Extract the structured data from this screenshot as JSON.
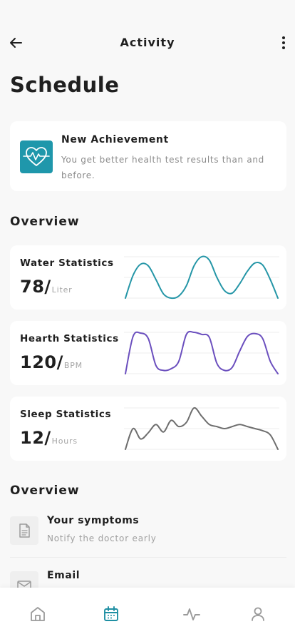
{
  "header": {
    "title": "Activity"
  },
  "page": {
    "heading": "Schedule"
  },
  "achievement": {
    "title": "New Achievement",
    "description": "You get better health test results than and before.",
    "icon": "heart-pulse-icon",
    "icon_bg": "#1f97ab"
  },
  "overview_title": "Overview",
  "stats": [
    {
      "title": "Water Statistics",
      "value": "78/",
      "unit": "Liter",
      "color": "#2596a7",
      "chart_data": {
        "type": "line",
        "x": [
          0,
          1,
          2,
          3,
          4,
          5,
          6,
          7,
          8,
          9,
          10,
          11,
          12,
          13,
          14,
          15,
          16,
          17,
          18,
          19,
          20
        ],
        "y": [
          0.0,
          0.55,
          0.82,
          0.78,
          0.45,
          0.1,
          0.0,
          0.05,
          0.3,
          0.78,
          1.0,
          0.92,
          0.5,
          0.18,
          0.12,
          0.35,
          0.65,
          0.85,
          0.8,
          0.45,
          0.0
        ]
      }
    },
    {
      "title": "Hearth Statistics",
      "value": "120/",
      "unit": "BPM",
      "color": "#6b4fbe",
      "chart_data": {
        "type": "line",
        "x": [
          0,
          1,
          2,
          3,
          4,
          5,
          6,
          7,
          8,
          9,
          10,
          11,
          12,
          13,
          14,
          15,
          16,
          17,
          18,
          19,
          20
        ],
        "y": [
          0.0,
          0.9,
          0.98,
          0.85,
          0.2,
          0.08,
          0.12,
          0.3,
          0.95,
          1.0,
          0.95,
          0.88,
          0.25,
          0.08,
          0.15,
          0.55,
          0.9,
          0.97,
          0.85,
          0.3,
          0.0
        ]
      }
    },
    {
      "title": "Sleep Statistics",
      "value": "12/",
      "unit": "Hours",
      "color": "#6e6e6e",
      "chart_data": {
        "type": "line",
        "x": [
          0,
          1,
          2,
          3,
          4,
          5,
          6,
          7,
          8,
          9,
          10,
          11,
          12,
          13,
          14,
          15,
          16,
          17,
          18,
          19,
          20
        ],
        "y": [
          0.0,
          0.5,
          0.25,
          0.4,
          0.6,
          0.42,
          0.7,
          0.55,
          0.65,
          1.0,
          0.8,
          0.6,
          0.55,
          0.5,
          0.55,
          0.6,
          0.55,
          0.5,
          0.45,
          0.35,
          0.0
        ]
      }
    }
  ],
  "overview2_title": "Overview",
  "list": [
    {
      "title": "Your symptoms",
      "subtitle": "Notify the doctor early",
      "icon": "document-icon"
    },
    {
      "title": "Email",
      "subtitle": "",
      "icon": "mail-icon"
    }
  ],
  "nav": {
    "items": [
      "home-icon",
      "calendar-icon",
      "activity-icon",
      "profile-icon"
    ],
    "active": 1,
    "active_color": "#1f8fa3",
    "inactive_color": "#9a9a9a"
  }
}
